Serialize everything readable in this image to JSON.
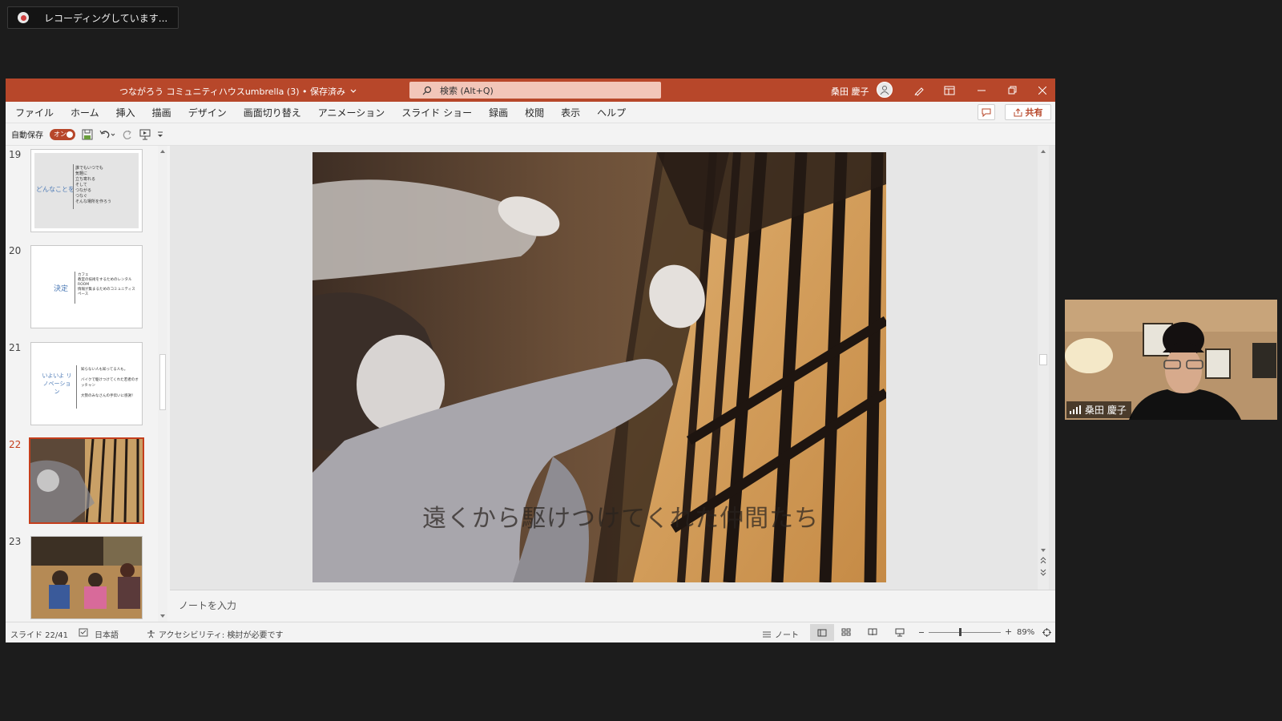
{
  "recording": {
    "text": "レコーディングしています..."
  },
  "titlebar": {
    "document_title": "つながろう コミュニティハウスumbrella (3) • 保存済み",
    "search_placeholder": "検索 (Alt+Q)",
    "user_name": "桑田 慶子"
  },
  "menu": {
    "items": [
      "ファイル",
      "ホーム",
      "挿入",
      "描画",
      "デザイン",
      "画面切り替え",
      "アニメーション",
      "スライド ショー",
      "録画",
      "校閲",
      "表示",
      "ヘルプ"
    ],
    "share_label": "共有"
  },
  "qat": {
    "autosave_label": "自動保存",
    "autosave_state": "オン"
  },
  "thumbnails": [
    {
      "number": "19",
      "title": "どんなことを",
      "lines": [
        "誰でもいつでも",
        "気軽に",
        "立ち寄れる",
        "そして",
        "つながる",
        "つなぐ",
        "そんな場所を作ろう"
      ]
    },
    {
      "number": "20",
      "title": "決定",
      "lines": [
        "カフェ",
        "教室の技術をするためのレンタルROOM",
        "情報が集まるためのコミュニティスペース"
      ]
    },
    {
      "number": "21",
      "title": "いよいよ リノベーション",
      "lines": [
        "知らない人も知ってる人も。",
        "バイクで駆けつけてくれた若者のオッチャン",
        "大勢のみなさんの手伝いに感謝！"
      ]
    },
    {
      "number": "22"
    },
    {
      "number": "23"
    }
  ],
  "slide": {
    "caption": "遠くから駆けつけてくれた仲間たち"
  },
  "notes": {
    "placeholder": "ノートを入力"
  },
  "status": {
    "slide_counter": "スライド 22/41",
    "language": "日本語",
    "accessibility": "アクセシビリティ: 検討が必要です",
    "notes_label": "ノート",
    "zoom": "89%"
  },
  "video": {
    "participant_name": "桑田 慶子"
  },
  "colors": {
    "accent": "#b7472a",
    "active_thumb": "#c43e1c"
  }
}
